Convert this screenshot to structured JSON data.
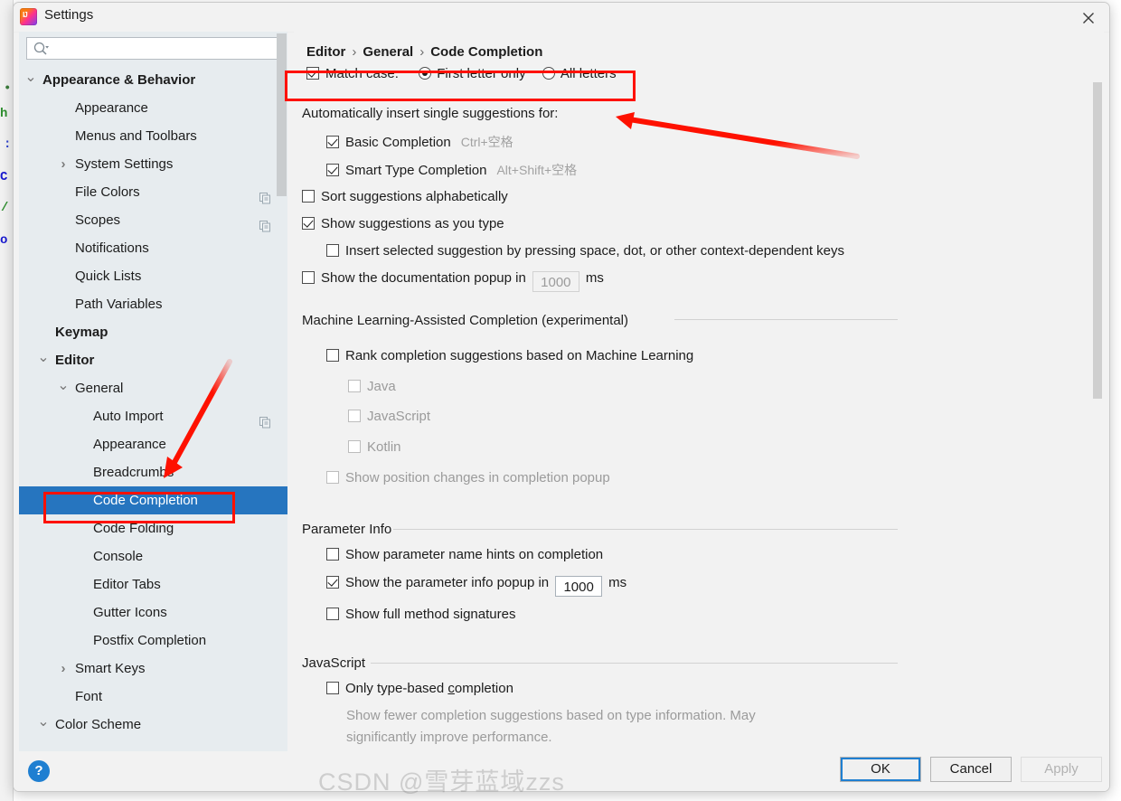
{
  "window": {
    "title": "Settings",
    "app_icon": "intellij-idea-icon",
    "close_icon": "close-icon"
  },
  "search": {
    "placeholder": "",
    "value": "",
    "icon": "search-icon"
  },
  "sidebar": {
    "scrollbar": "vertical-scrollbar",
    "items": [
      {
        "label": "Appearance & Behavior",
        "indent": 26,
        "bold": true,
        "twisty": "down",
        "copy": false,
        "selected": false
      },
      {
        "label": "Appearance",
        "indent": 62,
        "bold": false,
        "twisty": "none",
        "copy": false,
        "selected": false
      },
      {
        "label": "Menus and Toolbars",
        "indent": 62,
        "bold": false,
        "twisty": "none",
        "copy": false,
        "selected": false
      },
      {
        "label": "System Settings",
        "indent": 62,
        "bold": false,
        "twisty": "right",
        "copy": false,
        "selected": false
      },
      {
        "label": "File Colors",
        "indent": 62,
        "bold": false,
        "twisty": "none",
        "copy": true,
        "selected": false
      },
      {
        "label": "Scopes",
        "indent": 62,
        "bold": false,
        "twisty": "none",
        "copy": true,
        "selected": false
      },
      {
        "label": "Notifications",
        "indent": 62,
        "bold": false,
        "twisty": "none",
        "copy": false,
        "selected": false
      },
      {
        "label": "Quick Lists",
        "indent": 62,
        "bold": false,
        "twisty": "none",
        "copy": false,
        "selected": false
      },
      {
        "label": "Path Variables",
        "indent": 62,
        "bold": false,
        "twisty": "none",
        "copy": false,
        "selected": false
      },
      {
        "label": "Keymap",
        "indent": 40,
        "bold": true,
        "twisty": "none",
        "copy": false,
        "selected": false
      },
      {
        "label": "Editor",
        "indent": 40,
        "bold": true,
        "twisty": "down",
        "copy": false,
        "selected": false
      },
      {
        "label": "General",
        "indent": 62,
        "bold": false,
        "twisty": "down",
        "copy": false,
        "selected": false
      },
      {
        "label": "Auto Import",
        "indent": 82,
        "bold": false,
        "twisty": "none",
        "copy": true,
        "selected": false
      },
      {
        "label": "Appearance",
        "indent": 82,
        "bold": false,
        "twisty": "none",
        "copy": false,
        "selected": false
      },
      {
        "label": "Breadcrumbs",
        "indent": 82,
        "bold": false,
        "twisty": "none",
        "copy": false,
        "selected": false
      },
      {
        "label": "Code Completion",
        "indent": 82,
        "bold": false,
        "twisty": "none",
        "copy": false,
        "selected": true
      },
      {
        "label": "Code Folding",
        "indent": 82,
        "bold": false,
        "twisty": "none",
        "copy": false,
        "selected": false
      },
      {
        "label": "Console",
        "indent": 82,
        "bold": false,
        "twisty": "none",
        "copy": false,
        "selected": false
      },
      {
        "label": "Editor Tabs",
        "indent": 82,
        "bold": false,
        "twisty": "none",
        "copy": false,
        "selected": false
      },
      {
        "label": "Gutter Icons",
        "indent": 82,
        "bold": false,
        "twisty": "none",
        "copy": false,
        "selected": false
      },
      {
        "label": "Postfix Completion",
        "indent": 82,
        "bold": false,
        "twisty": "none",
        "copy": false,
        "selected": false
      },
      {
        "label": "Smart Keys",
        "indent": 62,
        "bold": false,
        "twisty": "right",
        "copy": false,
        "selected": false
      },
      {
        "label": "Font",
        "indent": 62,
        "bold": false,
        "twisty": "none",
        "copy": false,
        "selected": false
      },
      {
        "label": "Color Scheme",
        "indent": 40,
        "bold": false,
        "twisty": "down",
        "copy": false,
        "selected": false
      }
    ]
  },
  "breadcrumb": {
    "part1": "Editor",
    "sep1": "›",
    "part2": "General",
    "sep2": "›",
    "part3": "Code Completion"
  },
  "main": {
    "match_case": {
      "checkbox_label": "Match case:",
      "checked": true,
      "radio_first": "First letter only",
      "radio_first_selected": true,
      "radio_all": "All letters",
      "radio_all_selected": false
    },
    "auto_insert_label": "Automatically insert single suggestions for:",
    "auto_insert_items": [
      {
        "label": "Basic Completion",
        "shortcut": "Ctrl+空格",
        "checked": true
      },
      {
        "label": "Smart Type Completion",
        "shortcut": "Alt+Shift+空格",
        "checked": true
      }
    ],
    "sort_alphabetically": {
      "label": "Sort suggestions alphabetically",
      "checked": false
    },
    "show_as_you_type": {
      "label": "Show suggestions as you type",
      "checked": true
    },
    "insert_selected": {
      "label": "Insert selected suggestion by pressing space, dot, or other context-dependent keys",
      "checked": false
    },
    "doc_popup": {
      "label_before": "Show the documentation popup in",
      "value": "1000",
      "unit": "ms",
      "checked": false,
      "enabled": false
    },
    "ml_section": {
      "title": "Machine Learning-Assisted Completion (experimental)",
      "rank": {
        "label": "Rank completion suggestions based on Machine Learning",
        "checked": false,
        "enabled": true
      },
      "languages": [
        {
          "label": "Java",
          "checked": false,
          "enabled": false
        },
        {
          "label": "JavaScript",
          "checked": false,
          "enabled": false
        },
        {
          "label": "Kotlin",
          "checked": false,
          "enabled": false
        }
      ],
      "position_changes": {
        "label": "Show position changes in completion popup",
        "checked": false,
        "enabled": false
      }
    },
    "parameter_info": {
      "title": "Parameter Info",
      "name_hints": {
        "label": "Show parameter name hints on completion",
        "checked": false
      },
      "popup": {
        "label_before": "Show the parameter info popup in",
        "value": "1000",
        "unit": "ms",
        "checked": true,
        "enabled": true
      },
      "full_signatures": {
        "label": "Show full method signatures",
        "checked": false
      }
    },
    "javascript": {
      "title": "JavaScript",
      "type_based": {
        "label_a": "Only type-based ",
        "mnemonic": "c",
        "label_b": "ompletion",
        "checked": false
      },
      "description_line1": "Show fewer completion suggestions based on type information. May",
      "description_line2": "significantly improve performance."
    }
  },
  "footer": {
    "help_icon": "help-question-icon",
    "ok_label": "OK",
    "cancel_label": "Cancel",
    "apply_label": "Apply"
  },
  "watermark": {
    "text": "CSDN @雪芽蓝域zzs"
  },
  "colors": {
    "accent": "#2675bf",
    "annotation": "#fe1100",
    "panel": "#f2f2f2",
    "tree_bg": "#e7ecef",
    "help_blue": "#1f7fd1"
  }
}
